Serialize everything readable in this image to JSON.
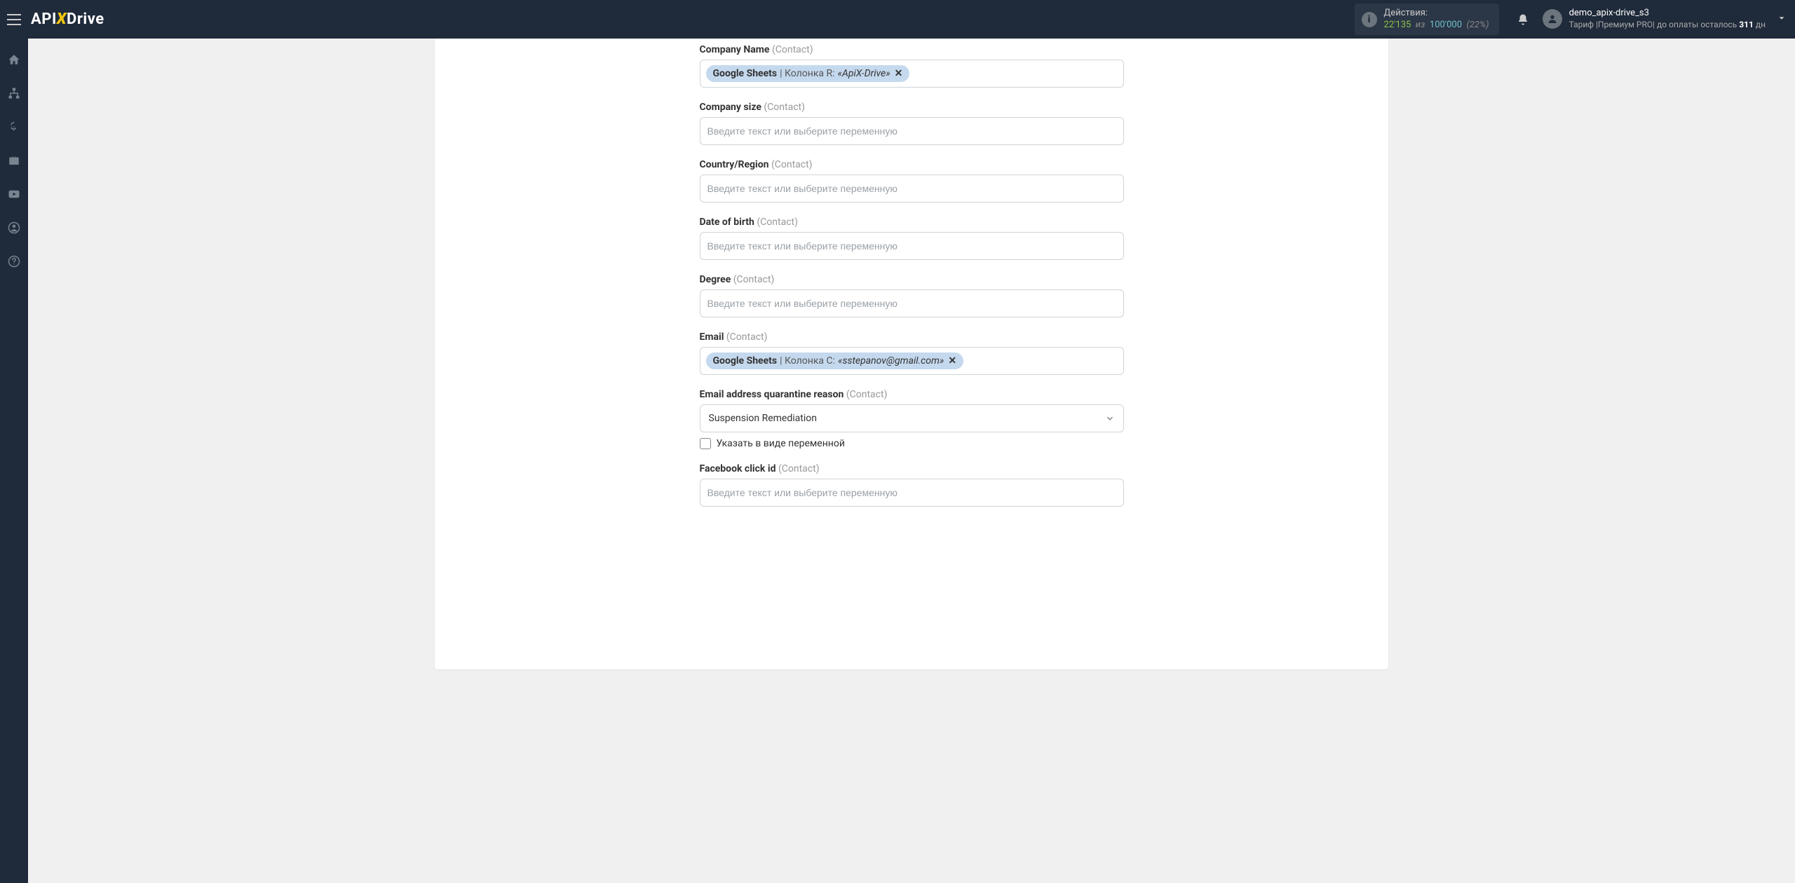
{
  "header": {
    "logo_part1": "API",
    "logo_x": "X",
    "logo_part2": "Drive",
    "actions_label": "Действия:",
    "actions_count": "22'135",
    "actions_of": "из",
    "actions_total": "100'000",
    "actions_pct": "(22%)",
    "user_name": "demo_apix-drive_s3",
    "tariff_prefix": "Тариф |Премиум PRO|  до оплаты осталось ",
    "tariff_days": "311",
    "tariff_suffix": " дн"
  },
  "form": {
    "placeholder": "Введите текст или выберите переменную",
    "fields": {
      "company_name": {
        "label": "Company Name",
        "sub": "(Contact)",
        "tag_source": "Google Sheets",
        "tag_text": " | Колонка R: ",
        "tag_value": "«ApiX-Drive»"
      },
      "company_size": {
        "label": "Company size",
        "sub": "(Contact)"
      },
      "country": {
        "label": "Country/Region",
        "sub": "(Contact)"
      },
      "dob": {
        "label": "Date of birth",
        "sub": "(Contact)"
      },
      "degree": {
        "label": "Degree",
        "sub": "(Contact)"
      },
      "email": {
        "label": "Email",
        "sub": "(Contact)",
        "tag_source": "Google Sheets",
        "tag_text": " | Колонка C: ",
        "tag_value": "«sstepanov@gmail.com»"
      },
      "quarantine": {
        "label": "Email address quarantine reason",
        "sub": "(Contact)",
        "select_value": "Suspension Remediation",
        "checkbox_label": "Указать в виде переменной"
      },
      "fb_click": {
        "label": "Facebook click id",
        "sub": "(Contact)"
      }
    }
  }
}
